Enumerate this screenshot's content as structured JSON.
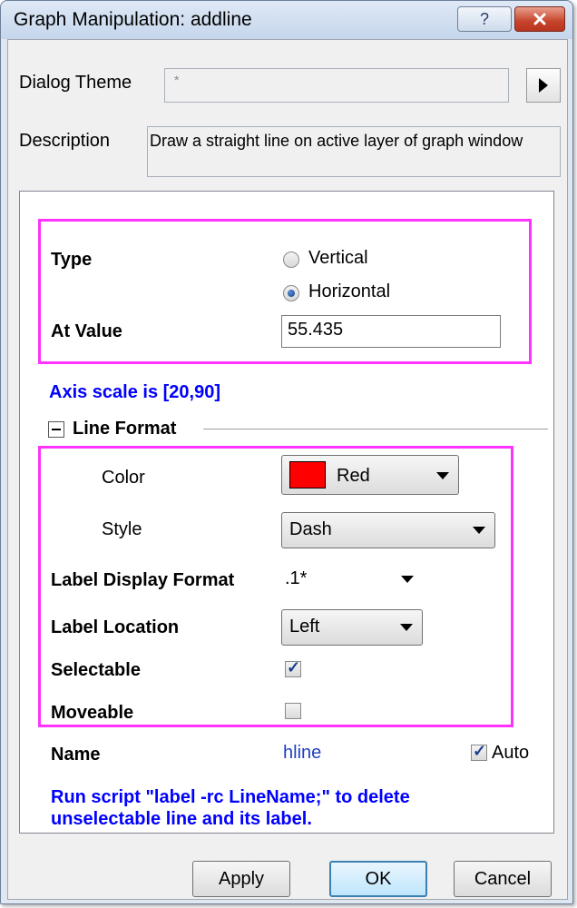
{
  "window": {
    "title": "Graph Manipulation: addline",
    "help_label": "?",
    "close_icon": "close-icon"
  },
  "header": {
    "theme_label": "Dialog Theme",
    "theme_value": "*",
    "description_label": "Description",
    "description_text": "Draw a straight line on active layer of graph window"
  },
  "type_group": {
    "type_label": "Type",
    "options": [
      {
        "label": "Vertical",
        "selected": false
      },
      {
        "label": "Horizontal",
        "selected": true
      }
    ],
    "at_value_label": "At Value",
    "at_value": "55.435"
  },
  "axis_scale_note": "Axis scale is [20,90]",
  "line_format": {
    "section_label": "Line Format",
    "color_label": "Color",
    "color_value": "Red",
    "color_swatch": "#ff0000",
    "style_label": "Style",
    "style_value": "Dash",
    "label_display_format_label": "Label Display Format",
    "label_display_format_value": ".1*",
    "label_location_label": "Label Location",
    "label_location_value": "Left",
    "selectable_label": "Selectable",
    "selectable_checked": true,
    "moveable_label": "Moveable",
    "moveable_checked": false
  },
  "name_row": {
    "name_label": "Name",
    "name_value": "hline",
    "auto_label": "Auto",
    "auto_checked": true
  },
  "hint_text": "Run script \"label -rc LineName;\" to delete unselectable line and its label.",
  "buttons": {
    "apply": "Apply",
    "ok": "OK",
    "cancel": "Cancel"
  },
  "colors": {
    "highlight_border": "#ff33ff",
    "link_blue": "#0000ff",
    "name_value_blue": "#1f3fbf"
  }
}
